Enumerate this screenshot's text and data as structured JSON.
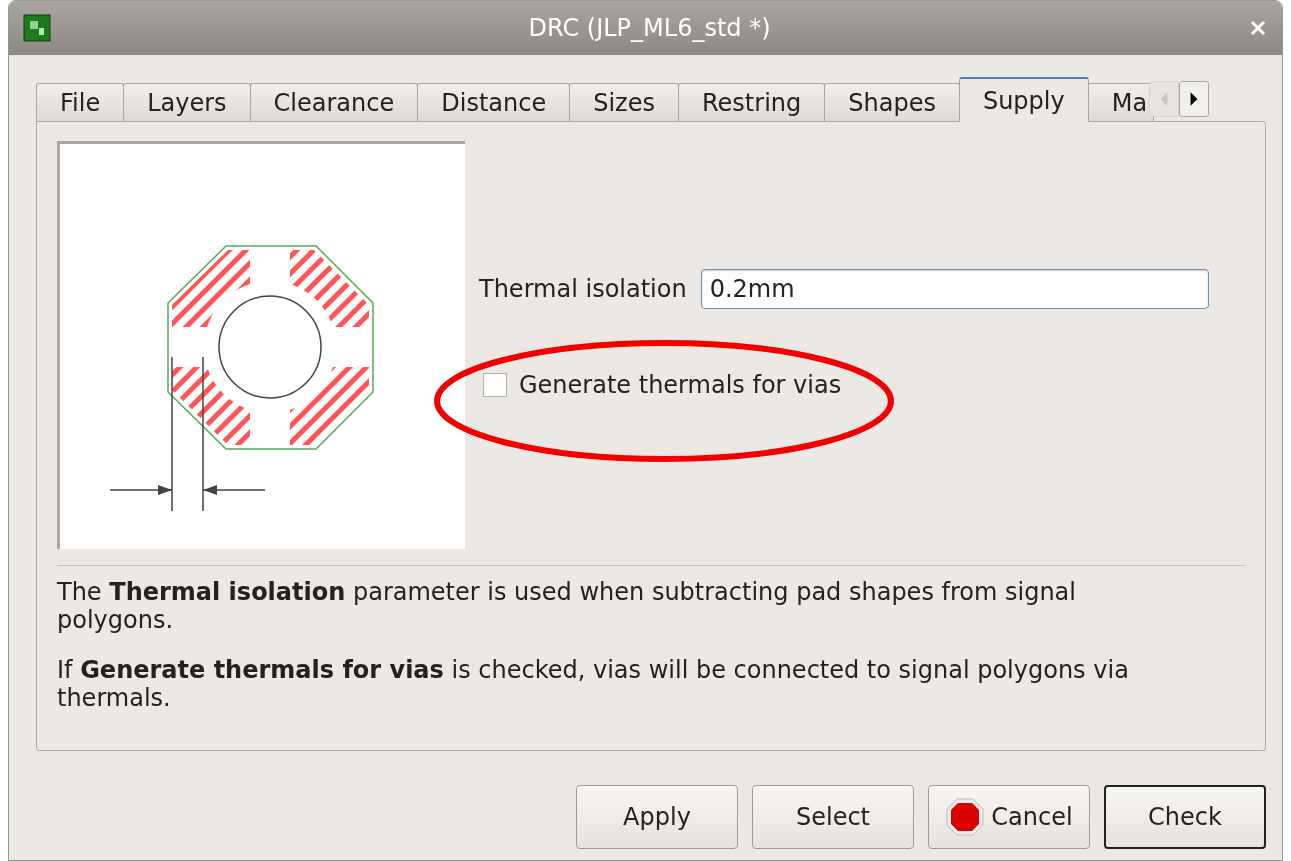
{
  "window": {
    "title": "DRC (JLP_ML6_std *)"
  },
  "tabs": [
    {
      "label": "File",
      "selected": false
    },
    {
      "label": "Layers",
      "selected": false
    },
    {
      "label": "Clearance",
      "selected": false
    },
    {
      "label": "Distance",
      "selected": false
    },
    {
      "label": "Sizes",
      "selected": false
    },
    {
      "label": "Restring",
      "selected": false
    },
    {
      "label": "Shapes",
      "selected": false
    },
    {
      "label": "Supply",
      "selected": true
    },
    {
      "label": "Ma",
      "selected": false
    }
  ],
  "tab_scroll": [
    {
      "kind": "left",
      "disabled": true
    },
    {
      "kind": "right",
      "disabled": false
    }
  ],
  "thermal_isolation": {
    "label": "Thermal isolation",
    "value": "0.2mm"
  },
  "generate_thermals": {
    "label": "Generate thermals for vias",
    "checked": false
  },
  "highlight": {
    "kind": "ellipse"
  },
  "description": [
    "The **Thermal isolation** parameter is used when subtracting pad shapes from signal polygons.",
    "If **Generate thermals for vias** is checked, vias will be connected to signal polygons via thermals."
  ],
  "buttons": [
    {
      "label": "Apply",
      "kind": "plain"
    },
    {
      "label": "Select",
      "kind": "plain"
    },
    {
      "label": "Cancel",
      "kind": "stop"
    },
    {
      "label": "Check",
      "kind": "default"
    }
  ]
}
